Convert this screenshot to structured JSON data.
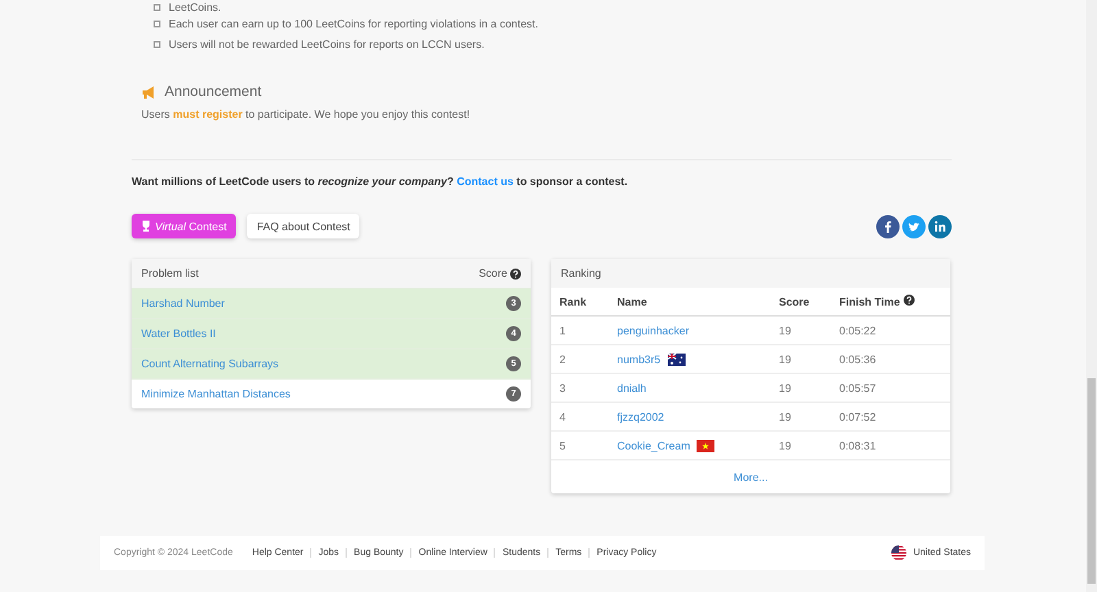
{
  "rules_tail": [
    "LeetCoins.",
    "Each user can earn up to 100 LeetCoins for reporting violations in a contest.",
    "Users will not be rewarded LeetCoins for reports on LCCN users."
  ],
  "announcement": {
    "title": "Announcement",
    "text": "Users **must register** to participate. We hope you enjoy this contest!"
  },
  "sponsor": {
    "before": "Want millions of LeetCode users to *recognize your company*?",
    "link": "Contact us",
    "after": "to sponsor a contest."
  },
  "buttons": {
    "virtual": "*Virtual* Contest",
    "faq": "FAQ about Contest"
  },
  "problem_list": {
    "title": "Problem list",
    "score_label": "Score",
    "problems": [
      {
        "name": "Harshad Number",
        "score": "3",
        "solved": true
      },
      {
        "name": "Water Bottles II",
        "score": "4",
        "solved": true
      },
      {
        "name": "Count Alternating Subarrays",
        "score": "5",
        "solved": true
      },
      {
        "name": "Minimize Manhattan Distances",
        "score": "7",
        "solved": false
      }
    ]
  },
  "ranking": {
    "title": "Ranking",
    "columns": [
      "Rank",
      "Name",
      "Score",
      "Finish Time"
    ],
    "rows": [
      {
        "rank": "1",
        "name": "penguinhacker",
        "kind": "plain",
        "score": "19",
        "time": "0:05:22"
      },
      {
        "rank": "2",
        "name": "numb3r5",
        "kind": "australia",
        "score": "19",
        "time": "0:05:36"
      },
      {
        "rank": "3",
        "name": "dnialh",
        "kind": "plain",
        "score": "19",
        "time": "0:05:57"
      },
      {
        "rank": "4",
        "name": "fjzzq2002",
        "kind": "plain",
        "score": "19",
        "time": "0:07:52"
      },
      {
        "rank": "5",
        "name": "Cookie_Cream",
        "kind": "vietnam",
        "score": "19",
        "time": "0:08:31"
      }
    ],
    "more": "More..."
  },
  "footer": {
    "copyright": "Copyright © 2024 LeetCode",
    "links": [
      "Help Center",
      "Jobs",
      "Bug Bounty",
      "Online Interview",
      "Students",
      "Terms",
      "Privacy Policy"
    ],
    "region": "United States"
  }
}
